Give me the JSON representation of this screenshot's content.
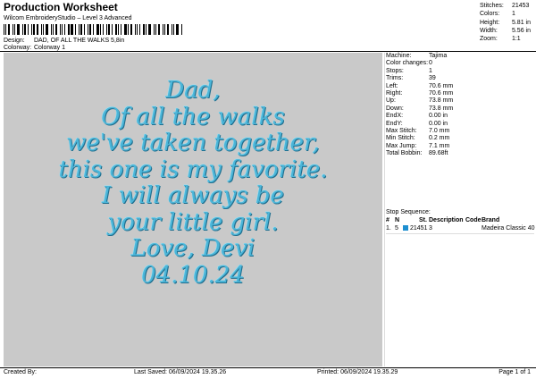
{
  "header": {
    "title": "Production Worksheet",
    "subtitle": "Wilcom EmbroideryStudio – Level 3 Advanced",
    "design_label": "Design:",
    "design_value": "DAD, OF ALL THE WALKS 5,8in",
    "colorway_label": "Colorway:",
    "colorway_value": "Colorway 1"
  },
  "summary": [
    {
      "label": "Stitches:",
      "value": "21453"
    },
    {
      "label": "Colors:",
      "value": "1"
    },
    {
      "label": "Height:",
      "value": "5.81 in"
    },
    {
      "label": "Width:",
      "value": "5.56 in"
    },
    {
      "label": "Zoom:",
      "value": "1:1"
    }
  ],
  "design_text": [
    "Dad,",
    "Of all the walks",
    "we've taken together,",
    "this one is my favorite.",
    "I will always be",
    "your little girl.",
    "Love, Devi",
    "04.10.24"
  ],
  "properties": [
    {
      "label": "Machine:",
      "value": "Tajima"
    },
    {
      "label": "Color changes:",
      "value": "0"
    },
    {
      "label": "Stops:",
      "value": "1"
    },
    {
      "label": "Trims:",
      "value": "39"
    },
    {
      "label": "Left:",
      "value": "70.6 mm"
    },
    {
      "label": "Right:",
      "value": "70.6 mm"
    },
    {
      "label": "Up:",
      "value": "73.8 mm"
    },
    {
      "label": "Down:",
      "value": "73.8 mm"
    },
    {
      "label": "EndX:",
      "value": "0.00 in"
    },
    {
      "label": "EndY:",
      "value": "0.00 in"
    },
    {
      "label": "Max Stitch:",
      "value": "7.0 mm"
    },
    {
      "label": "Min Stitch:",
      "value": "0.2 mm"
    },
    {
      "label": "Max Jump:",
      "value": "7.1 mm"
    },
    {
      "label": "Total Bobbin:",
      "value": "89.68ft"
    }
  ],
  "stop_sequence": {
    "title": "Stop Sequence:",
    "columns": {
      "n": "#",
      "n2": "N",
      "st": "St.",
      "description": "Description",
      "code": "Code",
      "brand": "Brand"
    },
    "rows": [
      {
        "n": "1.",
        "n2": "5",
        "swatch_color": "#1e8fd0",
        "st": "21451",
        "description": "3",
        "code": "",
        "brand": "Madeira Classic 40"
      }
    ]
  },
  "footer": {
    "created_by": "Created By:",
    "last_saved": "Last Saved: 06/09/2024 19.35.26",
    "printed": "Printed: 06/09/2024 19.35.29",
    "page": "Page 1 of 1"
  },
  "colors": {
    "thread": "#4bb5d8",
    "canvas": "#c9c9c9"
  }
}
